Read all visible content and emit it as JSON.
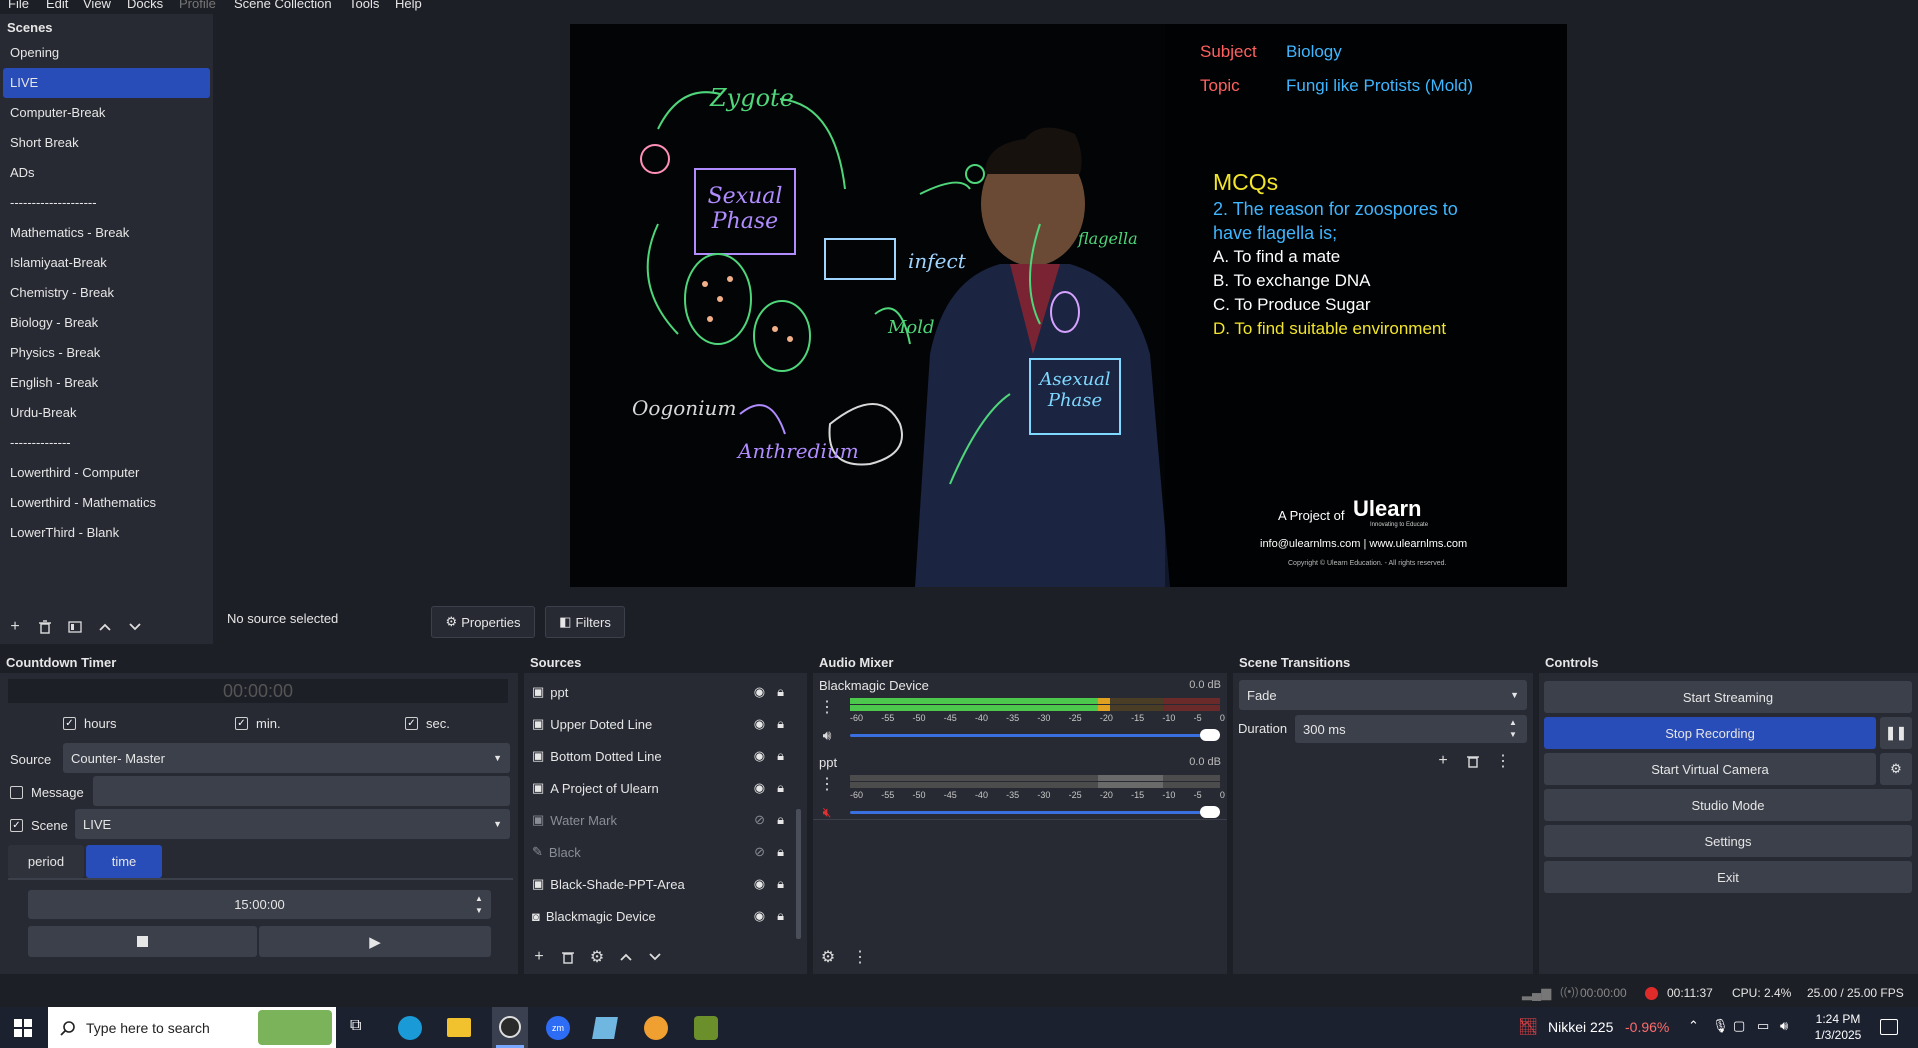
{
  "menu": [
    "File",
    "Edit",
    "View",
    "Docks",
    "Profile",
    "Scene Collection",
    "Tools",
    "Help"
  ],
  "scenes": {
    "title": "Scenes",
    "items": [
      "Opening",
      "LIVE",
      "Computer-Break",
      "Short Break",
      "ADs",
      "--------------------",
      "Mathematics  - Break",
      "Islamiyaat-Break",
      "Chemistry  - Break",
      "Biology  - Break",
      "Physics  - Break",
      "English - Break",
      "Urdu-Break",
      "--------------",
      "Lowerthird - Computer",
      "Lowerthird - Mathematics",
      "LowerThird - Blank"
    ],
    "selected": "LIVE"
  },
  "preview": {
    "subject_label": "Subject",
    "subject_value": "Biology",
    "topic_label": "Topic",
    "topic_value": "Fungi like Protists (Mold)",
    "mcq_title": "MCQs",
    "question_line1": "2. The reason for zoospores to",
    "question_line2": "have flagella is;",
    "option_a": "A. To find a mate",
    "option_b": "B. To exchange DNA",
    "option_c": "C. To Produce Sugar",
    "option_d": "D. To find suitable environment",
    "project_of": "A Project of",
    "brand": "Ulearn",
    "brand_tagline": "Innovating to Educate",
    "contact": "info@ulearnlms.com | www.ulearnlms.com",
    "copyright": "Copyright © Ulearn Education. - All rights reserved.",
    "board_labels": [
      "Zygote",
      "Sexual Phase",
      "infect",
      "Mold",
      "flagella",
      "Oogonium",
      "Anthredium",
      "Asexual Phase"
    ]
  },
  "source_bar": {
    "status": "No source selected",
    "properties": "Properties",
    "filters": "Filters"
  },
  "countdown": {
    "title": "Countdown Timer",
    "display": "00:00:00",
    "hours_label": "hours",
    "min_label": "min.",
    "sec_label": "sec.",
    "source_label": "Source",
    "source_value": "Counter- Master",
    "message_label": "Message",
    "scene_label": "Scene",
    "scene_value": "LIVE",
    "tab_period": "period",
    "tab_time": "time",
    "time_value": "15:00:00"
  },
  "sources": {
    "title": "Sources",
    "items": [
      {
        "name": "ppt",
        "visible": true,
        "icon": "image-icon"
      },
      {
        "name": "Upper Doted Line",
        "visible": true,
        "icon": "image-icon"
      },
      {
        "name": "Bottom Dotted Line",
        "visible": true,
        "icon": "image-icon"
      },
      {
        "name": "A Project of Ulearn",
        "visible": true,
        "icon": "image-icon"
      },
      {
        "name": "Water Mark",
        "visible": false,
        "icon": "image-icon"
      },
      {
        "name": "Black",
        "visible": false,
        "icon": "brush-icon"
      },
      {
        "name": "Black-Shade-PPT-Area",
        "visible": true,
        "icon": "image-icon"
      },
      {
        "name": "Blackmagic Device",
        "visible": true,
        "icon": "camera-icon"
      }
    ]
  },
  "audio": {
    "title": "Audio Mixer",
    "channels": [
      {
        "name": "Blackmagic Device",
        "db": "0.0 dB",
        "muted": false,
        "level": 0.72
      },
      {
        "name": "ppt",
        "db": "0.0 dB",
        "muted": true,
        "level": 0.0
      }
    ],
    "scale": [
      "-60",
      "-55",
      "-50",
      "-45",
      "-40",
      "-35",
      "-30",
      "-25",
      "-20",
      "-15",
      "-10",
      "-5",
      "0"
    ]
  },
  "transitions": {
    "title": "Scene Transitions",
    "type": "Fade",
    "duration_label": "Duration",
    "duration_value": "300 ms"
  },
  "controls": {
    "title": "Controls",
    "start_streaming": "Start Streaming",
    "stop_recording": "Stop Recording",
    "start_virtual_camera": "Start Virtual Camera",
    "studio_mode": "Studio Mode",
    "settings": "Settings",
    "exit": "Exit"
  },
  "statusbar": {
    "stream_time": "00:00:00",
    "rec_time": "00:11:37",
    "cpu": "CPU: 2.4%",
    "fps": "25.00 / 25.00 FPS"
  },
  "taskbar": {
    "search_placeholder": "Type here to search",
    "stock_name": "Nikkei 225",
    "stock_change": "-0.96%",
    "time": "1:24 PM",
    "date": "1/3/2025"
  },
  "colors": {
    "accent": "#284cb8",
    "panel": "#272a33",
    "background": "#1d1f26",
    "record_red": "#e02b2b",
    "stock_red": "#ff6b6b"
  }
}
